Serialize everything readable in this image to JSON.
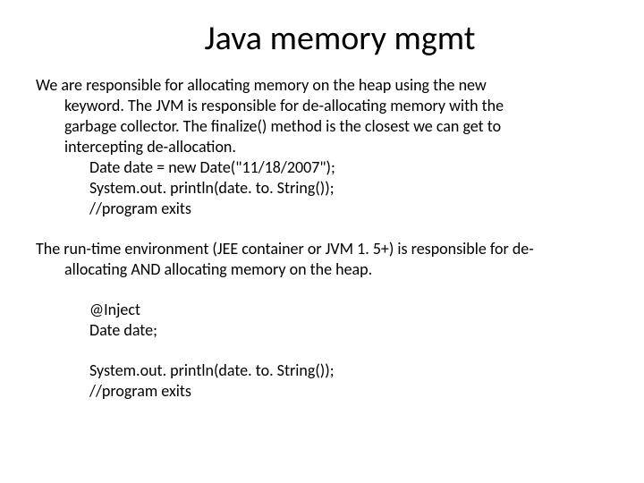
{
  "title": "Java memory mgmt",
  "para1": {
    "l1": "We are responsible for allocating memory on the heap using the new",
    "l2": "keyword. The JVM is responsible for de-allocating memory with the",
    "l3": "garbage collector.  The finalize() method is the closest we can get to",
    "l4": "intercepting de-allocation.",
    "c1": "Date date = new Date(\"11/18/2007\");",
    "c2": "System.out. println(date. to. String());",
    "c3": "//program exits"
  },
  "para2": {
    "l1": "The run-time environment (JEE container or JVM 1. 5+) is responsible for de-",
    "l2": "allocating AND allocating memory on the heap.",
    "c1": "@Inject",
    "c2": "Date date;",
    "c3": "System.out. println(date. to. String());",
    "c4": "//program exits"
  }
}
